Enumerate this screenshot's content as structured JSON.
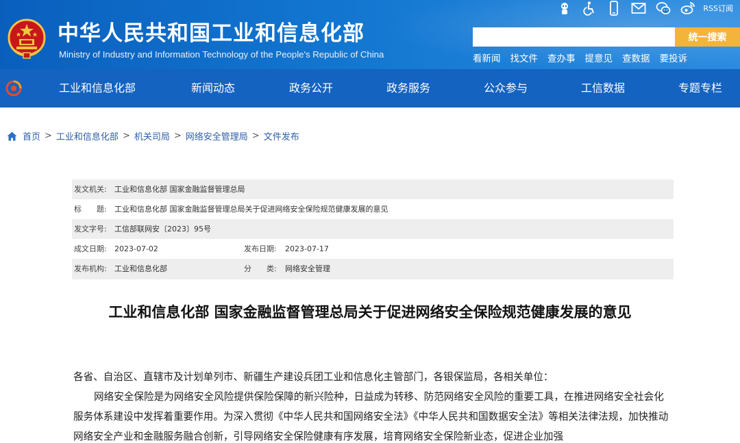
{
  "header": {
    "title": "中华人民共和国工业和信息化部",
    "subtitle": "Ministry of Industry and Information Technology of the People's Republic of China",
    "utility_icons": [
      "robot-icon",
      "accessibility-icon",
      "mobile-icon",
      "mail-icon",
      "wechat-icon",
      "weibo-icon"
    ],
    "rss_label": "RSS订阅",
    "search": {
      "placeholder": "",
      "button_label": "统一搜索"
    },
    "quick_links": [
      "看新闻",
      "找文件",
      "查办事",
      "提意见",
      "查数据",
      "要投诉"
    ]
  },
  "nav": {
    "items": [
      "工业和信息化部",
      "新闻动态",
      "政务公开",
      "政务服务",
      "公众参与",
      "工信数据",
      "专题专栏"
    ]
  },
  "breadcrumb": {
    "items": [
      "首页",
      "工业和信息化部",
      "机关司局",
      "网络安全管理局",
      "文件发布"
    ],
    "separator": ">"
  },
  "info": {
    "issuer_label": "发文机关:",
    "issuer_value": "工业和信息化部 国家金融监督管理总局",
    "title_label": "标　　题:",
    "title_value": "工业和信息化部 国家金融监督管理总局关于促进网络安全保险规范健康发展的意见",
    "docno_label": "发文字号:",
    "docno_value": "工信部联网安〔2023〕95号",
    "written_label": "成文日期:",
    "written_value": "2023-07-02",
    "published_label": "发布日期:",
    "published_value": "2023-07-17",
    "org_label": "发布机构:",
    "org_value": "工业和信息化部",
    "category_label": "分　　类:",
    "category_value": "网络安全管理"
  },
  "article": {
    "title": "工业和信息化部 国家金融监督管理总局关于促进网络安全保险规范健康发展的意见",
    "salutation": "各省、自治区、直辖市及计划单列市、新疆生产建设兵团工业和信息化主管部门，各银保监局，各相关单位：",
    "paragraph": "网络安全保险是为网络安全风险提供保险保障的新兴险种，日益成为转移、防范网络安全风险的重要工具，在推进网络安全社会化服务体系建设中发挥着重要作用。为深入贯彻《中华人民共和国网络安全法》《中华人民共和国数据安全法》等相关法律法规，加快推动网络安全产业和金融服务融合创新，引导网络安全保险健康有序发展，培育网络安全保险新业态，促进企业加强"
  },
  "colors": {
    "header_blue": "#1276d0",
    "nav_blue": "#1463c0",
    "search_button": "#f2b43a",
    "breadcrumb_link": "#2c5ea8",
    "table_shade": "#eeeeee"
  }
}
